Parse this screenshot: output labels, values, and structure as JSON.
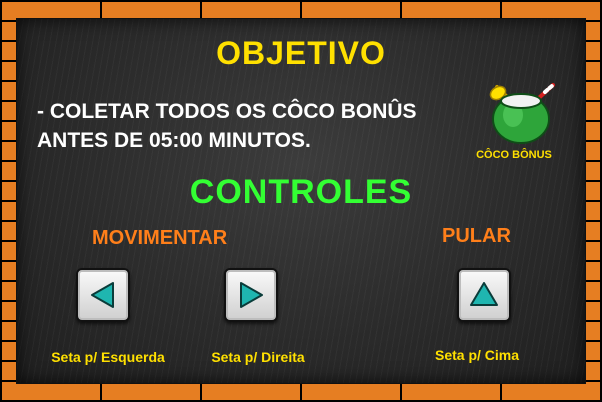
{
  "objective": {
    "title": "OBJETIVO",
    "line1": "- COLETAR TODOS OS CÔCO BONÛS",
    "line2": "ANTES DE 05:00 MINUTOS.",
    "bonus_icon": "coconut-drink-icon",
    "bonus_label": "CÔCO BÔNUS"
  },
  "controls": {
    "title": "CONTROLES",
    "move": {
      "label": "MOVIMENTAR",
      "left_icon": "arrow-left-icon",
      "left_caption": "Seta p/ Esquerda",
      "right_icon": "arrow-right-icon",
      "right_caption": "Seta p/ Direita"
    },
    "jump": {
      "label": "PULAR",
      "up_icon": "arrow-up-icon",
      "up_caption": "Seta p/ Cima"
    }
  },
  "colors": {
    "title_yellow": "#ffe000",
    "controls_green": "#33ff33",
    "section_orange": "#ff7f1a",
    "arrow_teal": "#1fb6b0",
    "frame_orange": "#e67e22"
  }
}
